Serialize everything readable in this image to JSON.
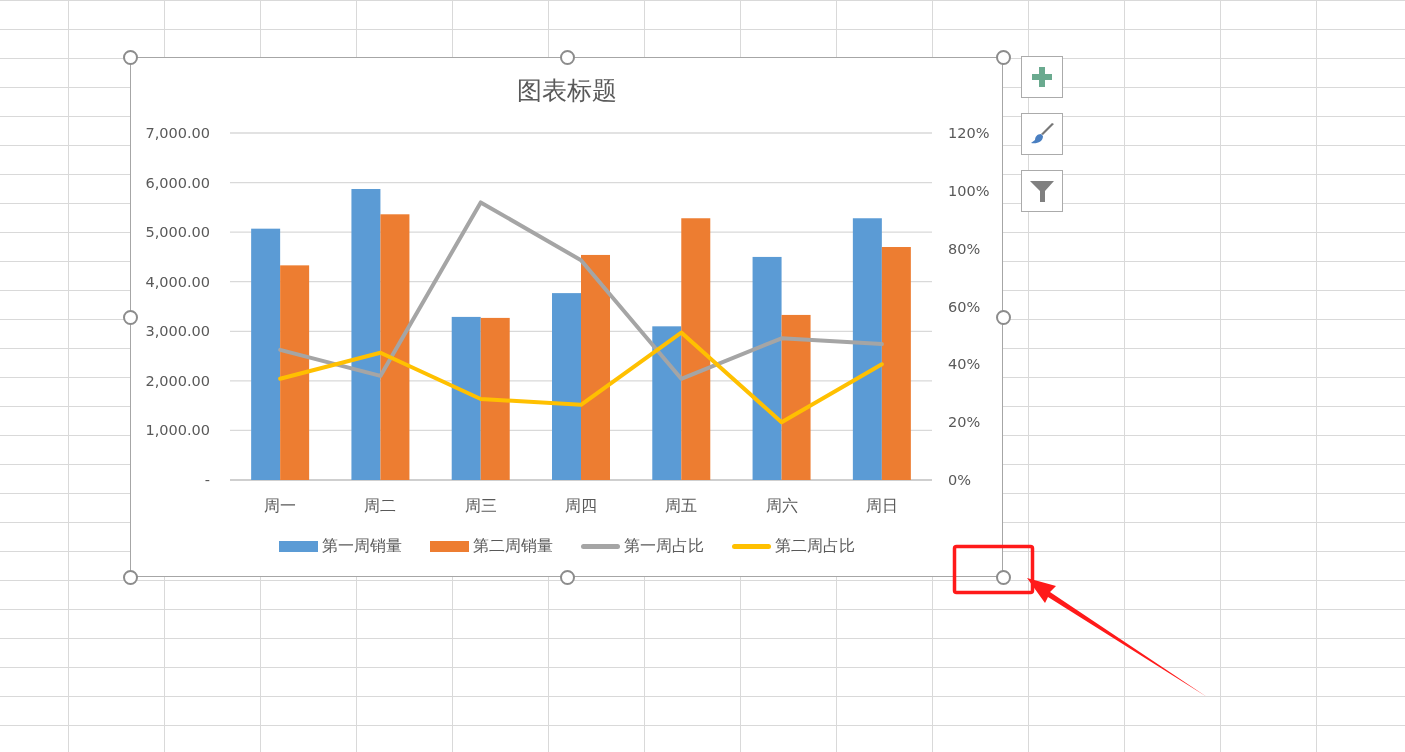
{
  "chart": {
    "chart_data": {
      "type": "bar",
      "title": "图表标题",
      "stacked": false,
      "grid": true,
      "categories": [
        "周一",
        "周二",
        "周三",
        "周四",
        "周五",
        "周六",
        "周日"
      ],
      "series": [
        {
          "name": "第一周销量",
          "color": "#5b9bd5",
          "values": [
            5070,
            5870,
            3290,
            3770,
            3100,
            4500,
            5280
          ]
        },
        {
          "name": "第二周销量",
          "color": "#ed7d31",
          "values": [
            4330,
            5360,
            3270,
            4540,
            5280,
            3330,
            4700
          ]
        },
        {
          "name": "第一周占比",
          "color": "#a5a5a5",
          "type": "line",
          "axis": "y2",
          "values": [
            45,
            36,
            96,
            76,
            35,
            49,
            47
          ]
        },
        {
          "name": "第二周占比",
          "color": "#ffc000",
          "type": "line",
          "axis": "y2",
          "values": [
            35,
            44,
            28,
            26,
            51,
            20,
            40
          ]
        }
      ],
      "ylim": [
        0,
        7000
      ],
      "yticks": [
        {
          "value": 0,
          "label": "-"
        },
        {
          "value": 1000,
          "label": "1,000.00"
        },
        {
          "value": 2000,
          "label": "2,000.00"
        },
        {
          "value": 3000,
          "label": "3,000.00"
        },
        {
          "value": 4000,
          "label": "4,000.00"
        },
        {
          "value": 5000,
          "label": "5,000.00"
        },
        {
          "value": 6000,
          "label": "6,000.00"
        },
        {
          "value": 7000,
          "label": "7,000.00"
        }
      ],
      "y2lim": [
        0,
        120
      ],
      "y2ticks": [
        {
          "value": 0,
          "label": "0%"
        },
        {
          "value": 20,
          "label": "20%"
        },
        {
          "value": 40,
          "label": "40%"
        },
        {
          "value": 60,
          "label": "60%"
        },
        {
          "value": 80,
          "label": "80%"
        },
        {
          "value": 100,
          "label": "100%"
        },
        {
          "value": 120,
          "label": "120%"
        }
      ]
    }
  },
  "chart_tools": [
    {
      "kind": "add"
    },
    {
      "kind": "style"
    },
    {
      "kind": "filter"
    }
  ],
  "annotation": {
    "kind": "callout"
  }
}
